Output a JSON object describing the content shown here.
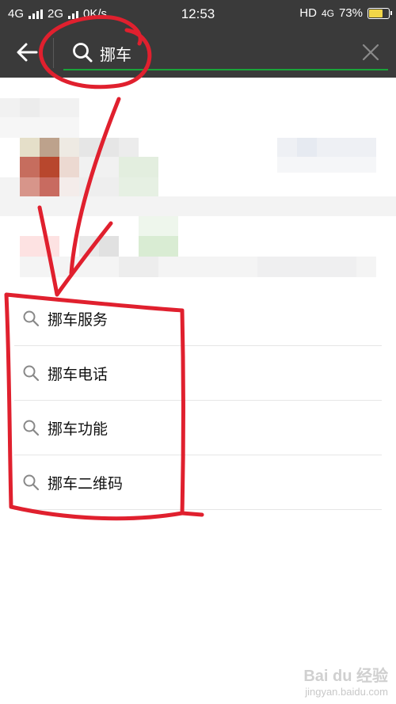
{
  "status": {
    "left": [
      "4G",
      "2G",
      "0K/s"
    ],
    "time": "12:53",
    "network": "HD",
    "network_type": "4G",
    "battery_pct": "73%",
    "battery_level": 0.73
  },
  "search": {
    "query": "挪车"
  },
  "suggestions": [
    {
      "label": "挪车服务"
    },
    {
      "label": "挪车电话"
    },
    {
      "label": "挪车功能"
    },
    {
      "label": "挪车二维码"
    }
  ],
  "watermark": {
    "line1": "Bai du 经验",
    "line2": "jingyan.baidu.com"
  },
  "colors": {
    "header_bg": "#3a3a3a",
    "accent_green": "#19a339",
    "annotation_red": "#e0202e"
  }
}
